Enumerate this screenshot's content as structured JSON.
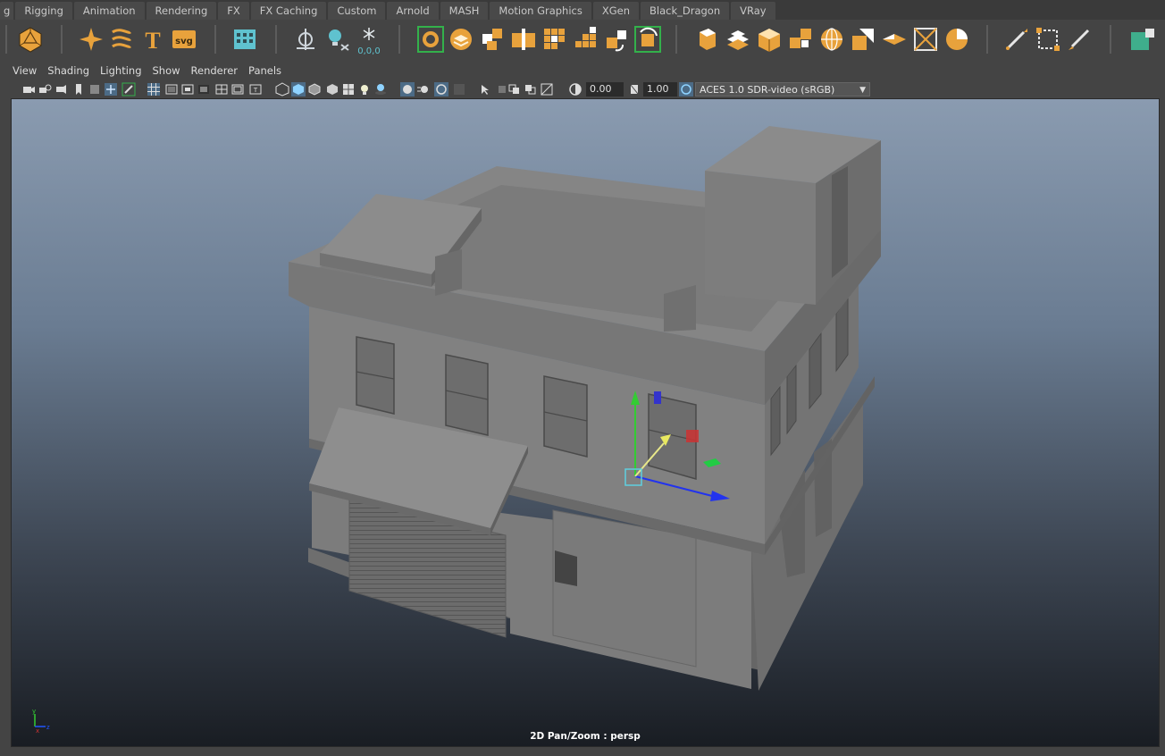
{
  "shelf_tabs": [
    "g",
    "Rigging",
    "Animation",
    "Rendering",
    "FX",
    "FX Caching",
    "Custom",
    "Arnold",
    "MASH",
    "Motion Graphics",
    "XGen",
    "Black_Dragon",
    "VRay"
  ],
  "shelf_icons": [
    {
      "name": "polyhedron-icon"
    },
    {
      "name": "sparkle-icon"
    },
    {
      "name": "twist-icon"
    },
    {
      "name": "type-text-icon",
      "glyph": "T"
    },
    {
      "name": "svg-icon",
      "glyph": "svg"
    },
    {
      "name": "grid-panel-icon"
    },
    {
      "name": "locator-icon"
    },
    {
      "name": "bulb-icon"
    },
    {
      "name": "snowflake-icon",
      "readout": "0,0,0"
    },
    {
      "name": "loop-select-icon"
    },
    {
      "name": "layers-icon"
    },
    {
      "name": "cube-split-icon"
    },
    {
      "name": "cube-stack-icon"
    },
    {
      "name": "grid-cube-icon"
    },
    {
      "name": "grid-steps-icon"
    },
    {
      "name": "rotate-cubes-icon"
    },
    {
      "name": "refresh-cube-icon"
    },
    {
      "name": "cube-outline-icon"
    },
    {
      "name": "flat-tiles-icon"
    },
    {
      "name": "cube-orange-icon"
    },
    {
      "name": "cubes-corner-icon"
    },
    {
      "name": "sphere-grid-icon"
    },
    {
      "name": "cube-cut-icon"
    },
    {
      "name": "plane-icon"
    },
    {
      "name": "box-frame-icon"
    },
    {
      "name": "sphere-split-icon"
    },
    {
      "name": "pen-icon"
    },
    {
      "name": "select-box-icon"
    },
    {
      "name": "brush-icon"
    },
    {
      "name": "teal-square-icon"
    }
  ],
  "panel_menu": [
    "View",
    "Shading",
    "Lighting",
    "Show",
    "Renderer",
    "Panels"
  ],
  "toolbar": {
    "exposure": "0.00",
    "gamma": "1.00",
    "color_space": "ACES 1.0 SDR-video (sRGB)"
  },
  "viewport": {
    "camera_label": "2D Pan/Zoom : persp"
  },
  "colors": {
    "accent_orange": "#e8a23c",
    "accent_teal": "#5fc2cf",
    "accent_green": "#33b14b"
  }
}
